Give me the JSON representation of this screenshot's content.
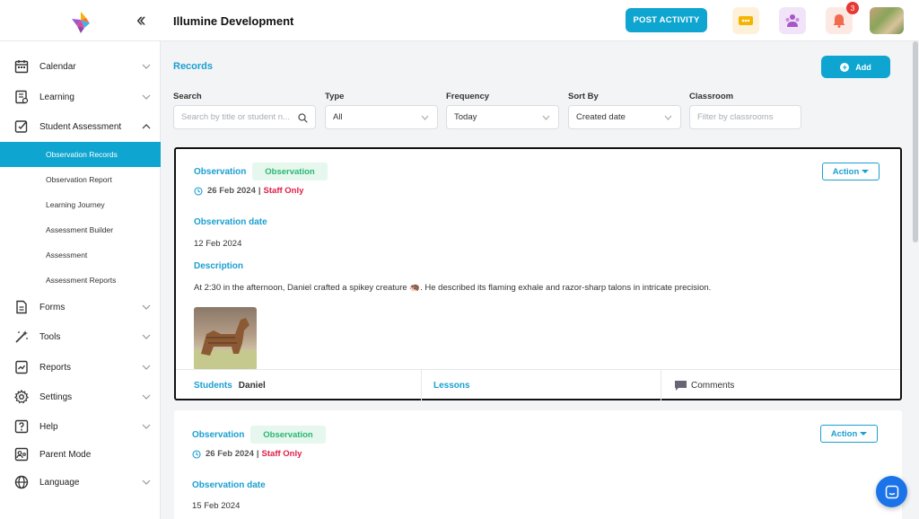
{
  "header": {
    "org_title": "Illumine Development",
    "post_activity_label": "POST ACTIVITY",
    "notification_count": "3"
  },
  "sidebar": {
    "items": [
      {
        "label": "Calendar",
        "icon": "calendar-icon"
      },
      {
        "label": "Learning",
        "icon": "learning-icon"
      },
      {
        "label": "Student Assessment",
        "icon": "assessment-icon"
      },
      {
        "label": "Forms",
        "icon": "forms-icon"
      },
      {
        "label": "Tools",
        "icon": "tools-icon"
      },
      {
        "label": "Reports",
        "icon": "reports-icon"
      },
      {
        "label": "Settings",
        "icon": "gear-icon"
      },
      {
        "label": "Help",
        "icon": "help-icon"
      },
      {
        "label": "Parent Mode",
        "icon": "parent-mode-icon"
      },
      {
        "label": "Language",
        "icon": "globe-icon"
      }
    ],
    "sub_items": [
      {
        "label": "Observation Records",
        "active": true
      },
      {
        "label": "Observation Report"
      },
      {
        "label": "Learning Journey"
      },
      {
        "label": "Assessment Builder"
      },
      {
        "label": "Assessment"
      },
      {
        "label": "Assessment Reports"
      }
    ]
  },
  "main": {
    "title": "Records",
    "add_label": "Add",
    "filters": {
      "search_label": "Search",
      "search_placeholder": "Search by title or student n...",
      "type_label": "Type",
      "type_value": "All",
      "frequency_label": "Frequency",
      "frequency_value": "Today",
      "sort_label": "Sort By",
      "sort_value": "Created date",
      "classroom_label": "Classroom",
      "classroom_placeholder": "Filter by classrooms"
    },
    "records": [
      {
        "type": "Observation",
        "tag": "Observation",
        "action_label": "Action",
        "created": "26 Feb 2024",
        "separator": "|",
        "visibility": "Staff Only",
        "obs_date_label": "Observation date",
        "obs_date": "12 Feb 2024",
        "desc_label": "Description",
        "description": "At 2:30 in the afternoon, Daniel crafted a spikey creature 🦔. He described its flaming exhale and razor-sharp talons in intricate precision.",
        "students_label": "Students",
        "student_name": "Daniel",
        "lessons_label": "Lessons",
        "comments_label": "Comments"
      },
      {
        "type": "Observation",
        "tag": "Observation",
        "action_label": "Action",
        "created": "26 Feb 2024",
        "separator": "|",
        "visibility": "Staff Only",
        "obs_date_label": "Observation date",
        "obs_date": "15 Feb 2024"
      }
    ]
  },
  "colors": {
    "accent": "#0ea5d0",
    "link": "#1a9fd0",
    "tag_bg": "#e6f7ee",
    "tag_text": "#2bb673",
    "staff_only": "#e11d48"
  }
}
